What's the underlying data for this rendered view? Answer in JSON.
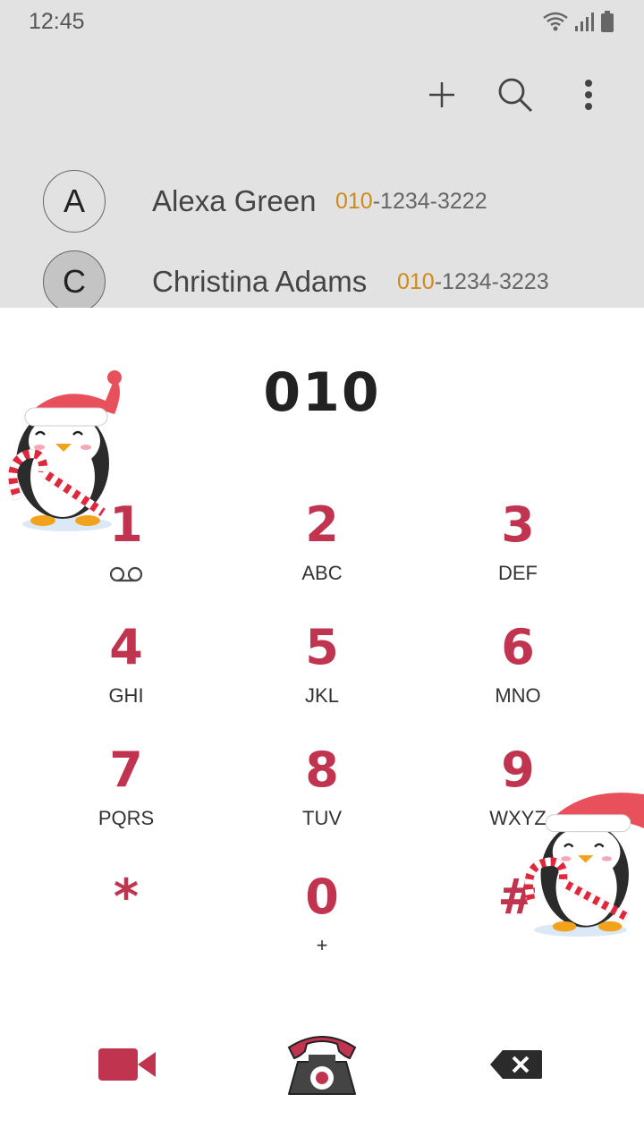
{
  "status": {
    "time": "12:45"
  },
  "actions": [
    {
      "name": "add-icon"
    },
    {
      "name": "search-icon"
    },
    {
      "name": "more-options-icon"
    }
  ],
  "contacts": [
    {
      "initial": "A",
      "name": "Alexa Green",
      "number_prefix": "010",
      "number_rest": "-1234-3222"
    },
    {
      "initial": "C",
      "name": "Christina Adams",
      "number_prefix": "010",
      "number_rest": "-1234-3223"
    }
  ],
  "dialer": {
    "input": "010"
  },
  "keys": [
    {
      "digit": "1",
      "letters": ""
    },
    {
      "digit": "2",
      "letters": "ABC"
    },
    {
      "digit": "3",
      "letters": "DEF"
    },
    {
      "digit": "4",
      "letters": "GHI"
    },
    {
      "digit": "5",
      "letters": "JKL"
    },
    {
      "digit": "6",
      "letters": "MNO"
    },
    {
      "digit": "7",
      "letters": "PQRS"
    },
    {
      "digit": "8",
      "letters": "TUV"
    },
    {
      "digit": "9",
      "letters": "WXYZ"
    },
    {
      "digit": "*",
      "letters": ""
    },
    {
      "digit": "0",
      "letters": "+"
    },
    {
      "digit": "#",
      "letters": ""
    }
  ],
  "bottom": {
    "video": "video-call-icon",
    "call": "call-icon",
    "delete": "backspace-icon"
  },
  "colors": {
    "accent": "#c0344f",
    "highlight": "#d08a1a",
    "header_bg": "#e2e2e2"
  }
}
